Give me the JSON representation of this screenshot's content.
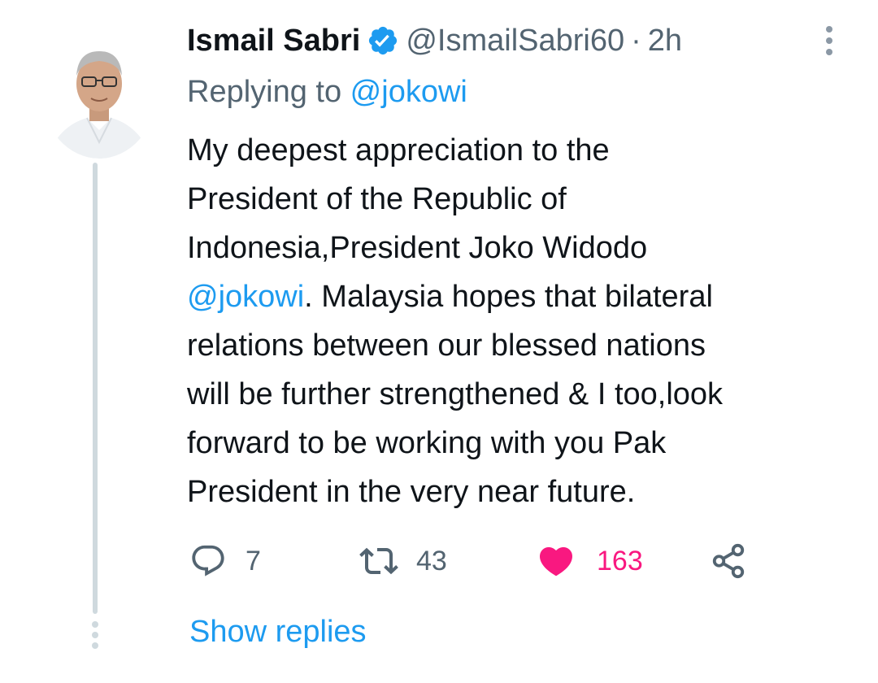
{
  "tweet": {
    "author": {
      "display_name": "Ismail Sabri",
      "handle": "@IsmailSabri60",
      "verified": true,
      "avatar_icon": "avatar-photo"
    },
    "separator": "·",
    "timestamp": "2h",
    "replying_to_prefix": "Replying to ",
    "replying_to_handle": "@jokowi",
    "text_lines": [
      "My deepest appreciation to the",
      "President of the Republic of",
      "Indonesia,President Joko Widodo"
    ],
    "text_mention": "@jokowi",
    "text_after_mention": ". Malaysia hopes that bilateral",
    "text_lines_after": [
      "relations between our blessed nations",
      "will be further strengthened & I too,look",
      "forward to be working with you Pak",
      "President in the very near future."
    ],
    "actions": {
      "reply_count": "7",
      "retweet_count": "43",
      "like_count": "163",
      "liked": true
    },
    "show_replies_label": "Show replies"
  },
  "colors": {
    "text": "#0f1419",
    "secondary": "#536471",
    "link": "#1d9bf0",
    "like": "#f91880",
    "verified": "#1d9bf0",
    "thread_line": "#cfd9de"
  }
}
